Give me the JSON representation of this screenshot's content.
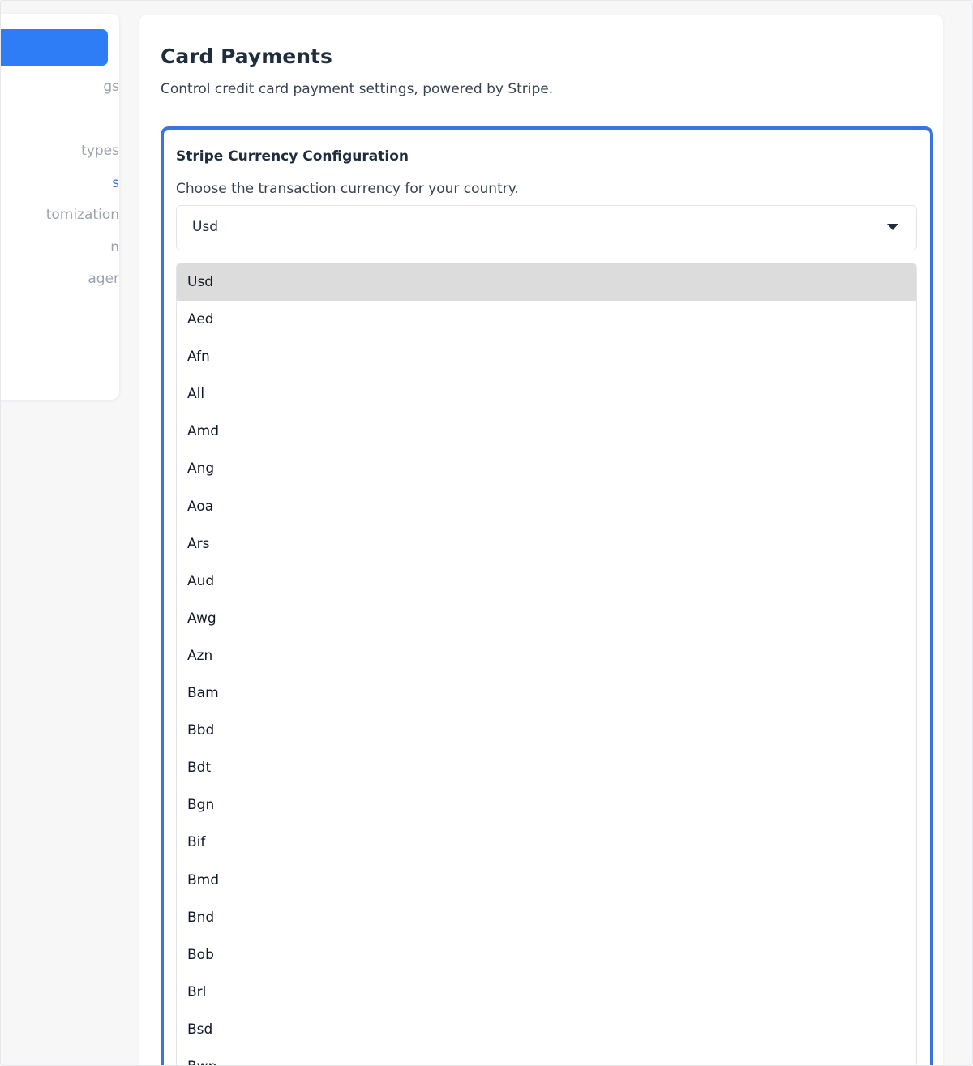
{
  "sidebar": {
    "items": [
      {
        "label": "gs",
        "top": 0
      },
      {
        "label": "types"
      },
      {
        "label": "s"
      },
      {
        "label": "tomization"
      },
      {
        "label": "n"
      },
      {
        "label": "ager"
      }
    ],
    "accent_color": "#2e7cf6"
  },
  "main": {
    "title": "Card Payments",
    "subtitle": "Control credit card payment settings, powered by Stripe."
  },
  "config": {
    "title": "Stripe Currency Configuration",
    "description": "Choose the transaction currency for your country.",
    "selected_value": "Usd",
    "border_color": "#3b74e0",
    "options": [
      "Usd",
      "Aed",
      "Afn",
      "All",
      "Amd",
      "Ang",
      "Aoa",
      "Ars",
      "Aud",
      "Awg",
      "Azn",
      "Bam",
      "Bbd",
      "Bdt",
      "Bgn",
      "Bif",
      "Bmd",
      "Bnd",
      "Bob",
      "Brl",
      "Bsd",
      "Bwp"
    ]
  }
}
